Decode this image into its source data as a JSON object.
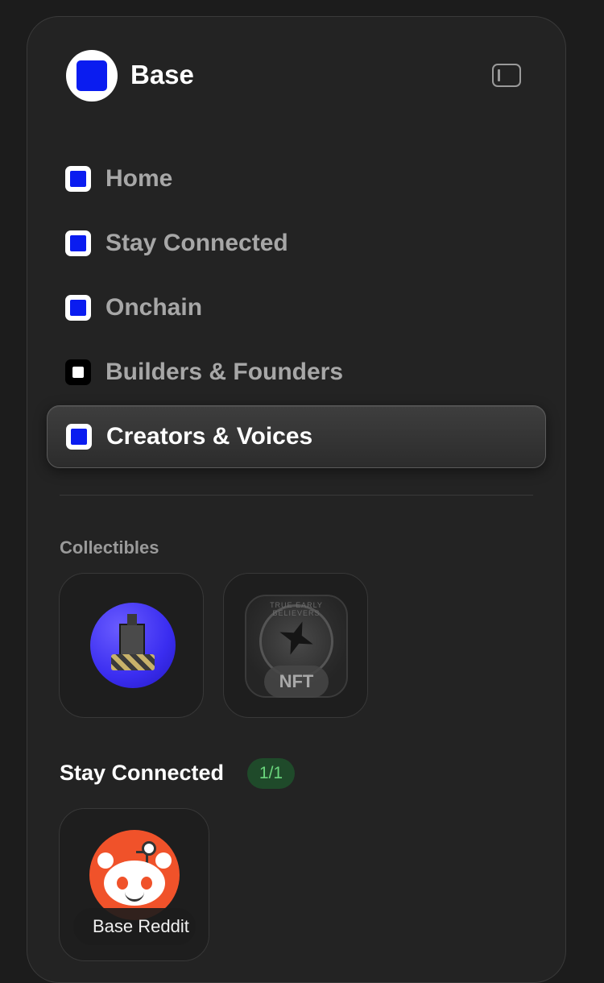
{
  "brand": {
    "name": "Base"
  },
  "nav": {
    "items": [
      {
        "label": "Home",
        "icon": "blue-square-icon"
      },
      {
        "label": "Stay Connected",
        "icon": "blue-square-icon"
      },
      {
        "label": "Onchain",
        "icon": "blue-square-icon"
      },
      {
        "label": "Builders & Founders",
        "icon": "white-square-icon"
      },
      {
        "label": "Creators & Voices",
        "icon": "blue-square-icon",
        "active": true
      }
    ]
  },
  "collectibles": {
    "title": "Collectibles",
    "items": [
      {
        "name": "blue-sphere-nft"
      },
      {
        "name": "early-believers-nft",
        "tag": "NFT",
        "arc_text": "TRUE EARLY BELIEVERS"
      }
    ]
  },
  "stay_connected": {
    "title": "Stay Connected",
    "badge": "1/1",
    "items": [
      {
        "label": "Base Reddit",
        "icon": "reddit-icon"
      }
    ]
  },
  "colors": {
    "accent": "#0a1cf0",
    "badge_bg": "#1f4a2a",
    "badge_text": "#6bd67d"
  }
}
